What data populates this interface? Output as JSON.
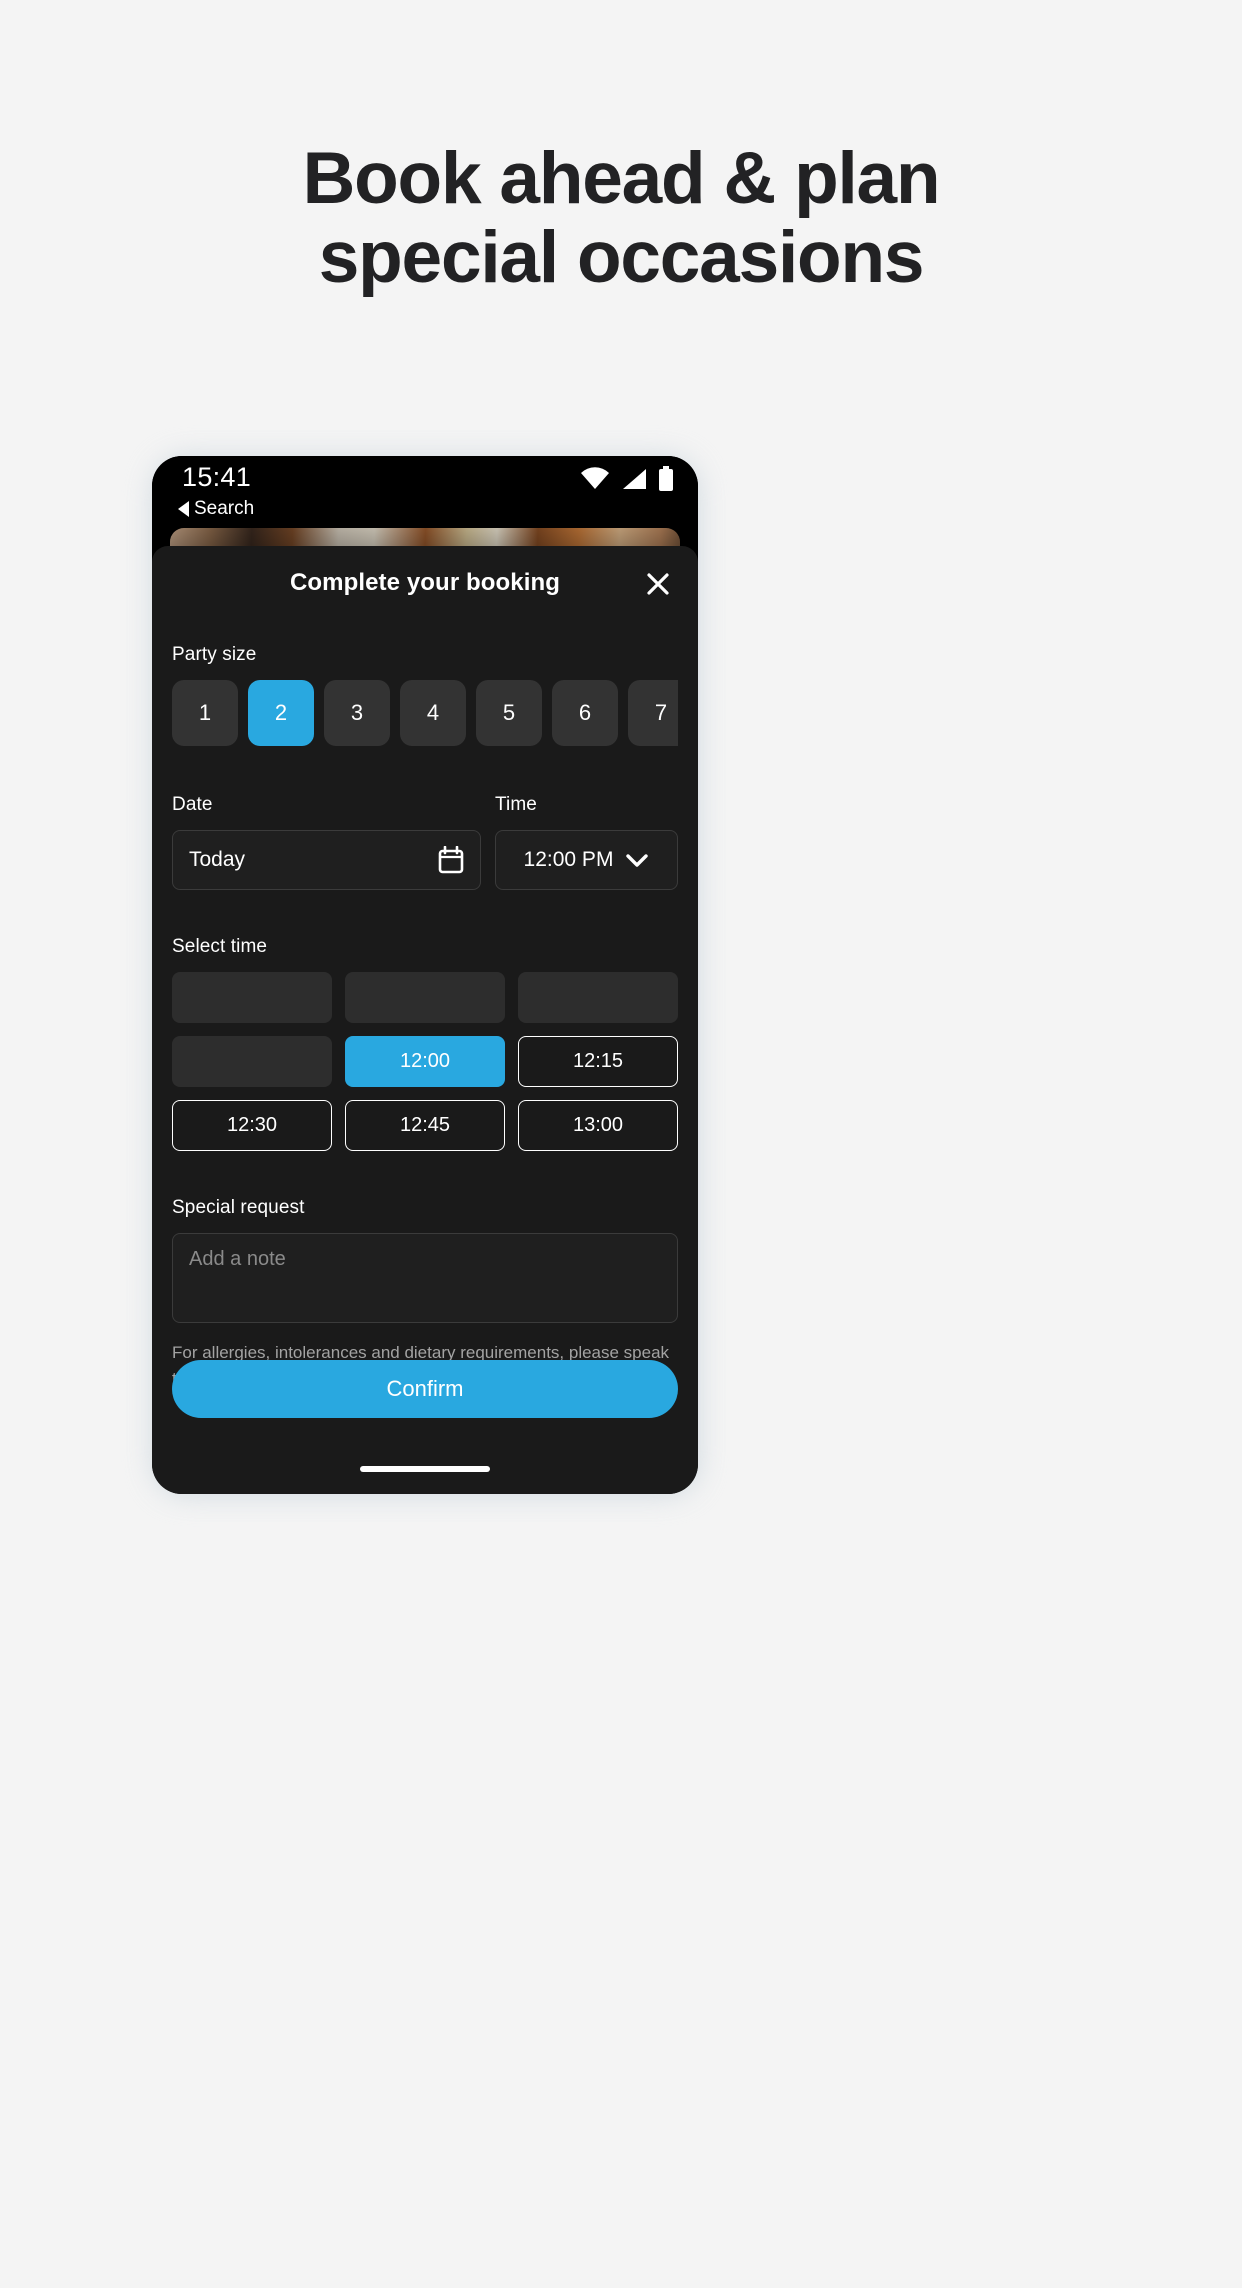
{
  "promo": {
    "headline_line1": "Book ahead & plan",
    "headline_line2": "special occasions"
  },
  "statusbar": {
    "time": "15:41",
    "back_label": "Search",
    "icons": [
      "wifi-icon",
      "cellular-signal-icon",
      "battery-icon"
    ]
  },
  "sheet": {
    "title": "Complete your booking",
    "close_icon": "close-icon"
  },
  "party_size": {
    "label": "Party size",
    "options": [
      "1",
      "2",
      "3",
      "4",
      "5",
      "6",
      "7"
    ],
    "selected": "2"
  },
  "date_field": {
    "label": "Date",
    "value": "Today",
    "icon": "calendar-icon"
  },
  "time_field": {
    "label": "Time",
    "value": "12:00 PM",
    "icon": "chevron-down-icon"
  },
  "select_time": {
    "label": "Select time",
    "slots": [
      {
        "label": "",
        "state": "empty"
      },
      {
        "label": "",
        "state": "empty"
      },
      {
        "label": "",
        "state": "empty"
      },
      {
        "label": "",
        "state": "empty"
      },
      {
        "label": "12:00",
        "state": "selected"
      },
      {
        "label": "12:15",
        "state": "available"
      },
      {
        "label": "12:30",
        "state": "available"
      },
      {
        "label": "12:45",
        "state": "available"
      },
      {
        "label": "13:00",
        "state": "available"
      }
    ]
  },
  "special_request": {
    "label": "Special request",
    "placeholder": "Add a note",
    "value": "",
    "help_text": "For allergies, intolerances and dietary requirements, please speak to the restaurant directly."
  },
  "confirm": {
    "label": "Confirm"
  },
  "colors": {
    "accent": "#29a8e0",
    "sheet_bg": "#1a1a1a",
    "page_bg": "#f4f4f4",
    "chip_bg": "#333333"
  }
}
